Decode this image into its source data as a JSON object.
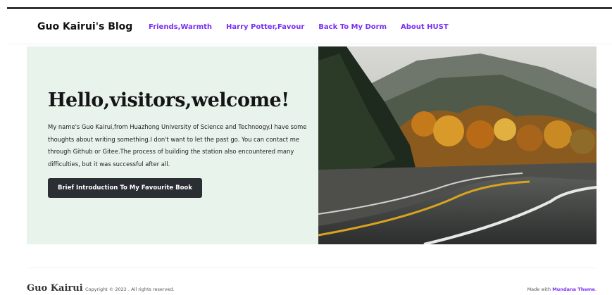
{
  "navbar": {
    "brand": "Guo Kairui's Blog",
    "links": [
      "Friends,Warmth",
      "Harry Potter,Favour",
      "Back To My Dorm",
      "About HUST"
    ],
    "link_color": "#7b2ff7"
  },
  "hero": {
    "title": "Hello,visitors,welcome!",
    "description": "My name's Guo Kairui,from Huazhong University of Science and Technoogy.I have some thoughts about writing something.I don't want to let the past go. You can contact me through Github or Gitee.The process of building the station also encountered many difficulties, but it was successful after all.",
    "button_label": "Brief Introduction To My Favourite Book",
    "background_color": "#e8f3ec",
    "image_icon": "autumn-road-photo"
  },
  "footer": {
    "brand": "Guo Kairui",
    "copyright": "Copyright © 2022 . All rights reserved.",
    "made_with_prefix": "Made with",
    "theme_name": "Mundana Theme",
    "suffix": "."
  }
}
